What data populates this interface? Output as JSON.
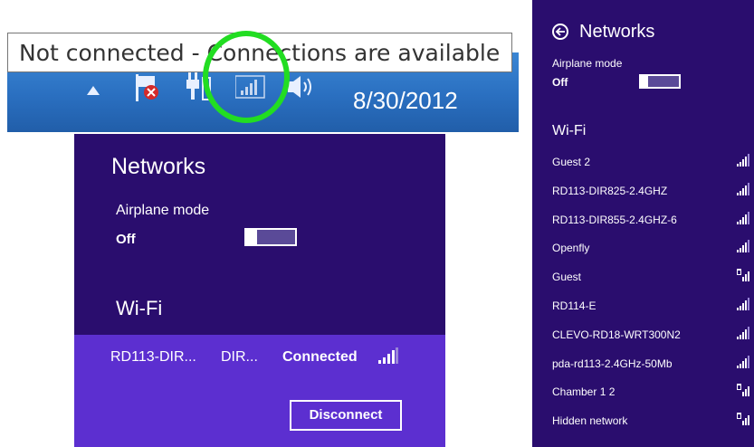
{
  "taskbar": {
    "tooltip": "Not connected - Connections are available",
    "date": "8/30/2012",
    "icons": [
      "show-hidden-icons-arrow",
      "action-center-flag-error-icon",
      "power-icon",
      "network-signal-icon",
      "speaker-icon"
    ]
  },
  "flyout_left": {
    "title": "Networks",
    "airplane_label": "Airplane mode",
    "airplane_state": "Off",
    "wifi_label": "Wi-Fi",
    "connected": {
      "ssid_part1": "RD113-DIR...",
      "ssid_part2": "DIR...",
      "status": "Connected",
      "button": "Disconnect"
    }
  },
  "flyout_right": {
    "title": "Networks",
    "airplane_label": "Airplane mode",
    "airplane_state": "Off",
    "wifi_label": "Wi-Fi",
    "networks": [
      {
        "name": "Guest 2",
        "secured": false
      },
      {
        "name": "RD113-DIR825-2.4GHZ",
        "secured": false
      },
      {
        "name": "RD113-DIR855-2.4GHZ-6",
        "secured": false
      },
      {
        "name": "Openfly",
        "secured": false
      },
      {
        "name": "Guest",
        "secured": true
      },
      {
        "name": "RD114-E",
        "secured": false
      },
      {
        "name": "CLEVO-RD18-WRT300N2",
        "secured": false
      },
      {
        "name": "pda-rd113-2.4GHz-50Mb",
        "secured": false
      },
      {
        "name": "Chamber 1 2",
        "secured": true
      },
      {
        "name": "Hidden network",
        "secured": true
      }
    ]
  },
  "colors": {
    "flyout_bg": "#2a0d6e",
    "connected_bg": "#5c2fd0",
    "taskbar_bg": "#2a6fc0",
    "highlight": "#22dd22"
  }
}
